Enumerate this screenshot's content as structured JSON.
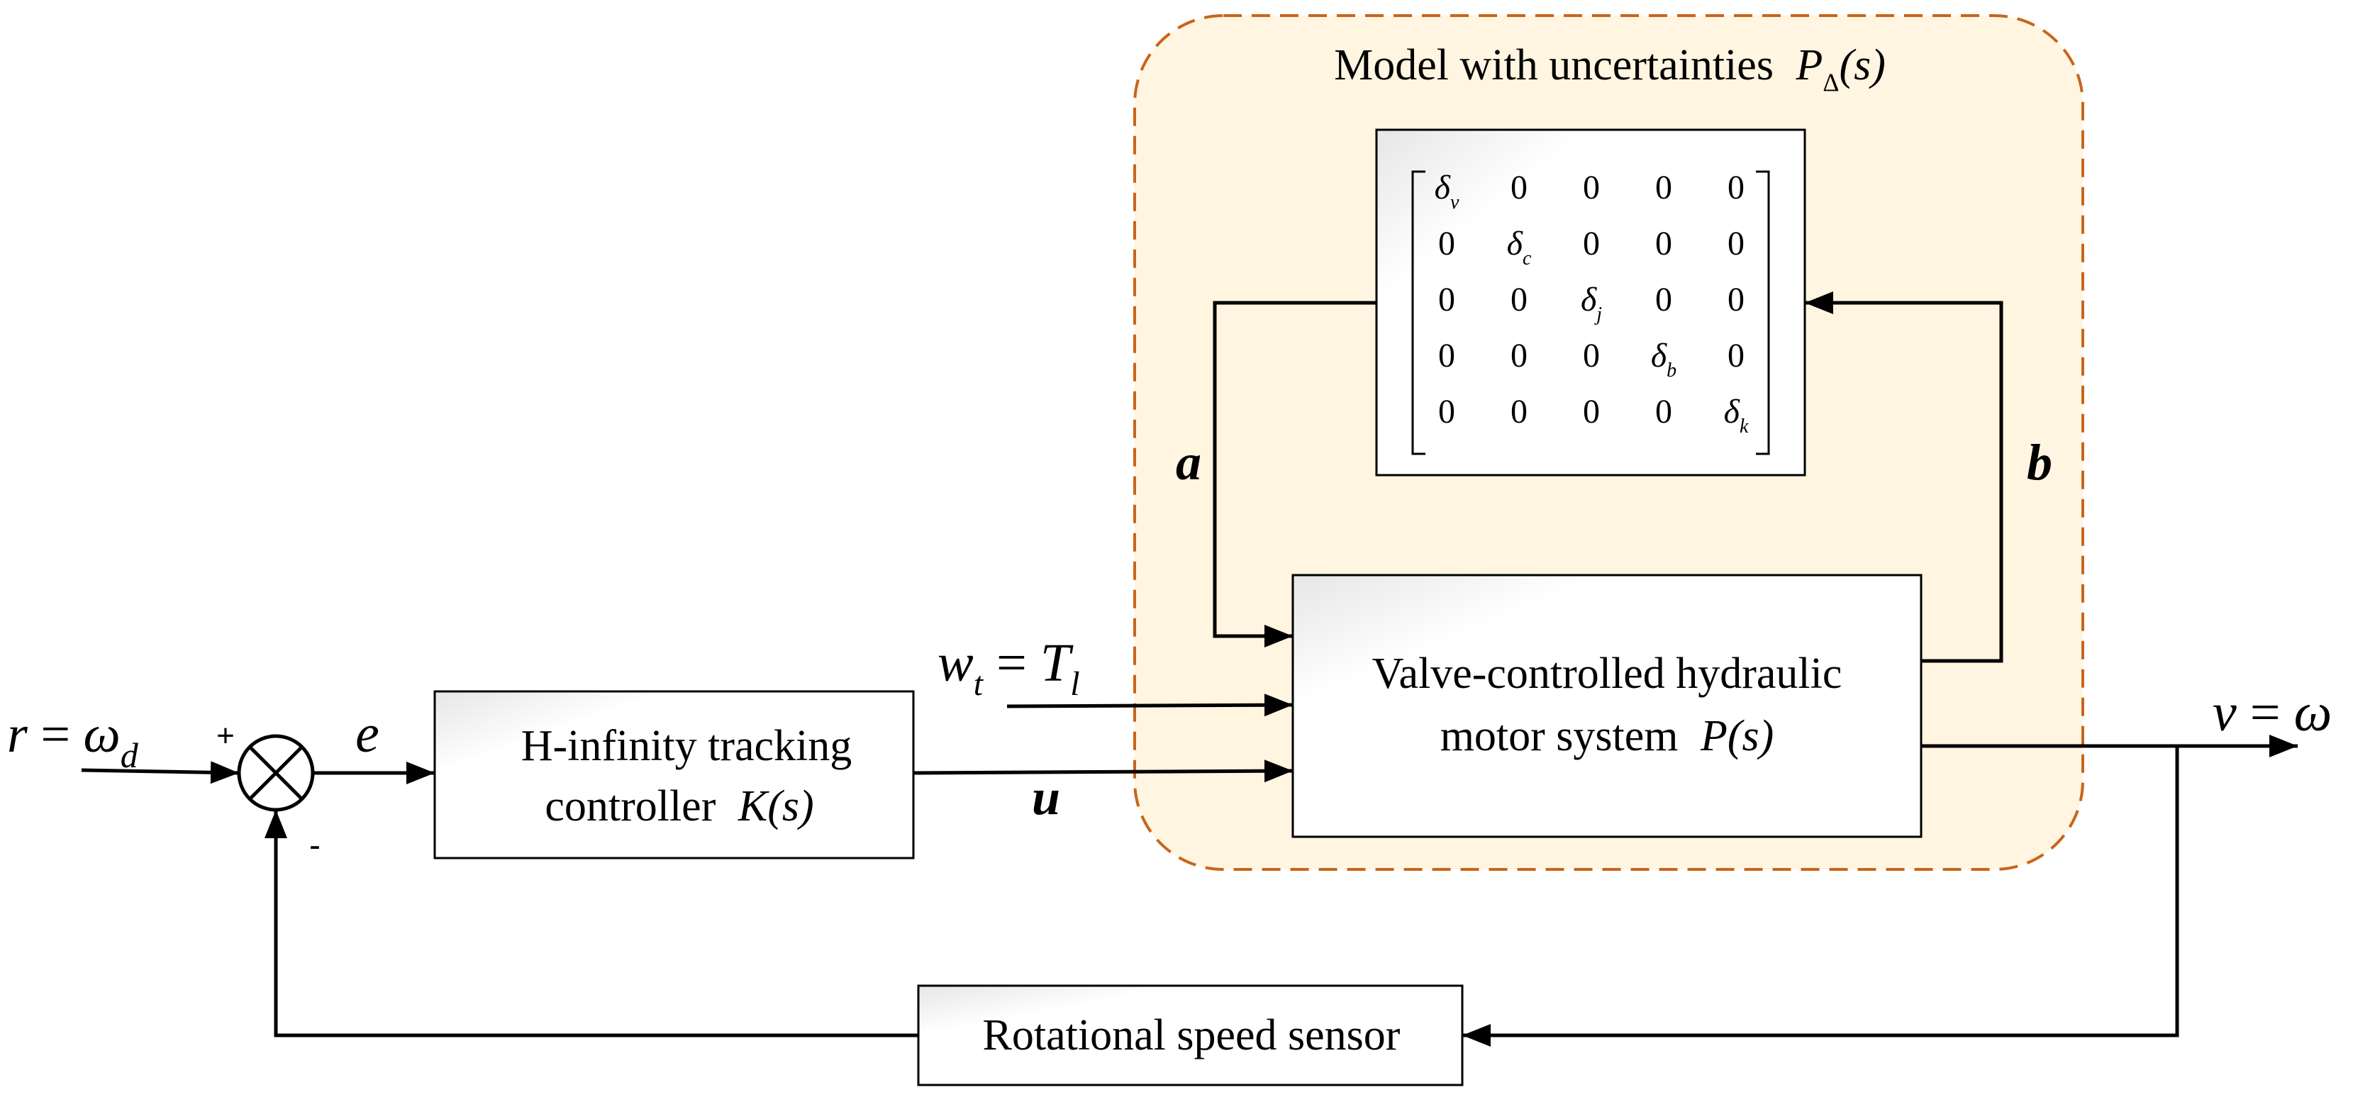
{
  "diagram": {
    "type": "control-block-diagram",
    "colors": {
      "uncertainty_region_fill": "#FFF5E1",
      "uncertainty_region_border": "#C8651B",
      "line": "#000000",
      "block_fill": "#FFFFFF"
    },
    "uncertainty_region": {
      "title": "Model with uncertainties",
      "symbol_main": "P",
      "symbol_sub": "Δ",
      "symbol_arg": "(s)"
    },
    "uncertainty_matrix": {
      "rows": [
        [
          {
            "b": "δ",
            "s": "v"
          },
          {
            "b": "0"
          },
          {
            "b": "0"
          },
          {
            "b": "0"
          },
          {
            "b": "0"
          }
        ],
        [
          {
            "b": "0"
          },
          {
            "b": "δ",
            "s": "c"
          },
          {
            "b": "0"
          },
          {
            "b": "0"
          },
          {
            "b": "0"
          }
        ],
        [
          {
            "b": "0"
          },
          {
            "b": "0"
          },
          {
            "b": "δ",
            "s": "j"
          },
          {
            "b": "0"
          },
          {
            "b": "0"
          }
        ],
        [
          {
            "b": "0"
          },
          {
            "b": "0"
          },
          {
            "b": "0"
          },
          {
            "b": "δ",
            "s": "b"
          },
          {
            "b": "0"
          }
        ],
        [
          {
            "b": "0"
          },
          {
            "b": "0"
          },
          {
            "b": "0"
          },
          {
            "b": "0"
          },
          {
            "b": "δ",
            "s": "k"
          }
        ]
      ]
    },
    "blocks": {
      "controller": {
        "line1": "H-infinity tracking",
        "line2": "controller",
        "symbol": "K",
        "arg": "(s)"
      },
      "plant": {
        "line1": "Valve-controlled hydraulic",
        "line2": "motor system",
        "symbol": "P",
        "arg": "(s)"
      },
      "sensor": {
        "label": "Rotational speed sensor"
      }
    },
    "signals": {
      "reference": {
        "lhs": "r",
        "eq": " = ",
        "rhs": "ω",
        "sub": "d"
      },
      "error": "e",
      "control": "u",
      "disturbance": {
        "lhs": "w",
        "lhs_sub": "t",
        "eq": " = ",
        "rhs": "T",
        "rhs_sub": "l"
      },
      "output": {
        "lhs": "v",
        "eq": " = ",
        "rhs": "ω"
      },
      "loop_a": "a",
      "loop_b": "b"
    },
    "summing_junction": {
      "plus": "+",
      "minus": "-"
    }
  }
}
